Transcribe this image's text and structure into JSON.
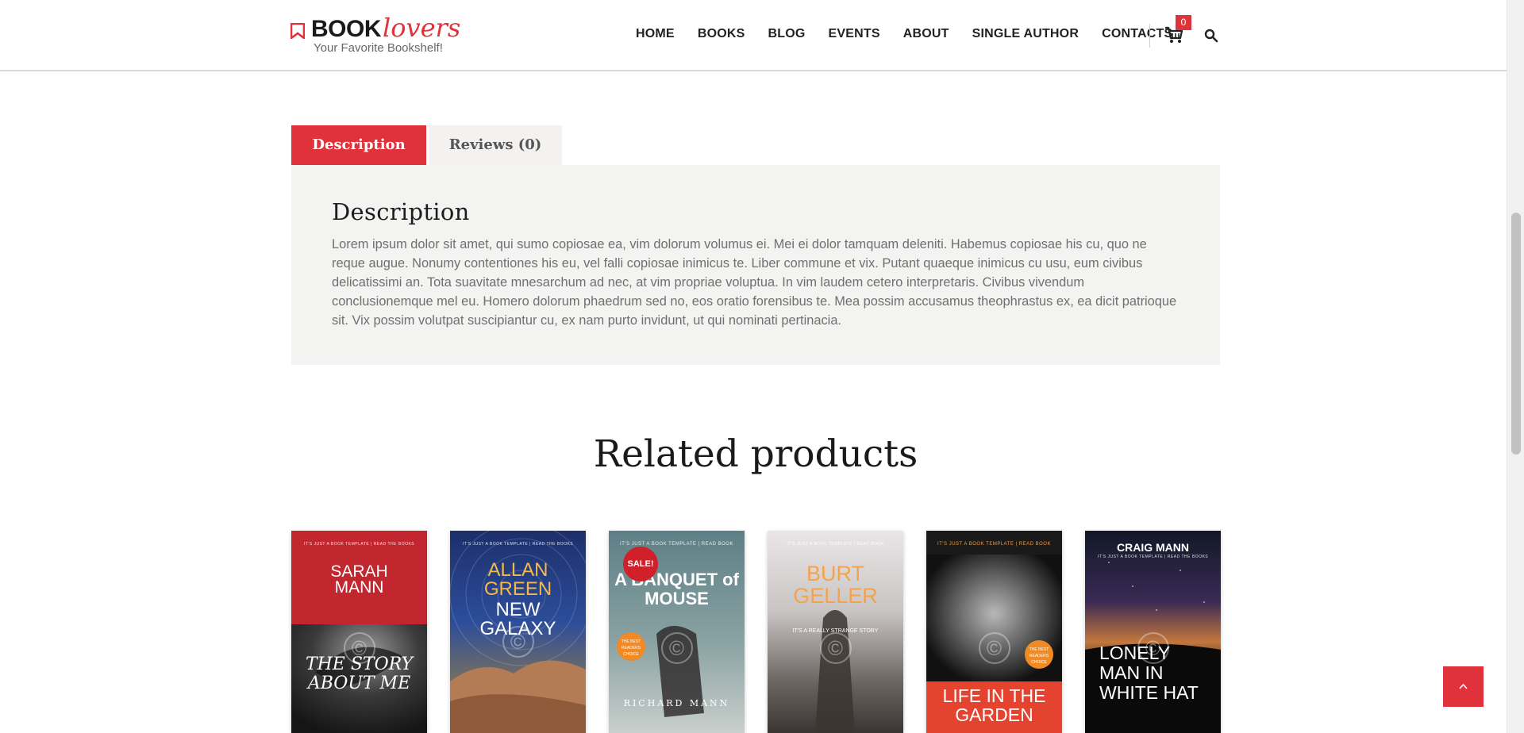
{
  "brand": {
    "name_bold": "BOOK",
    "name_italic": "lovers",
    "tagline": "Your Favorite Bookshelf!",
    "accent": "#e0323a"
  },
  "nav": {
    "items": [
      "HOME",
      "BOOKS",
      "BLOG",
      "EVENTS",
      "ABOUT",
      "SINGLE AUTHOR",
      "CONTACTS"
    ],
    "cart_count": "0"
  },
  "tabs": {
    "description_label": "Description",
    "reviews_label": "Reviews (0)"
  },
  "description": {
    "heading": "Description",
    "body": "Lorem ipsum dolor sit amet, qui sumo copiosae ea, vim dolorum volumus ei. Mei ei dolor tamquam deleniti. Habemus copiosae his cu, quo ne reque augue. Nonumy contentiones his eu, vel falli copiosae inimicus te. Liber commune et vix. Putant quaeque inimicus cu usu, eum civibus delicatissimi an. Tota suavitate mnesarchum ad nec, at vim propriae voluptua. In vim laudem cetero interpretaris. Civibus vivendum conclusionemque mel eu. Homero dolorum phaedrum sed no, eos oratio forensibus te. Mea possim accusamus theophrastus ex, ea dicit patrioque sit. Vix possim volutpat suscipiantur cu, ex nam purto invidunt, ut qui nominati pertinacia."
  },
  "related": {
    "heading": "Related products",
    "books": [
      {
        "author": "SARAH MANN",
        "title": "THE STORY ABOUT ME",
        "top": "IT'S JUST A BOOK TEMPLATE | READ THE BOOKS"
      },
      {
        "author": "ALLAN GREEN",
        "title": "NEW GALAXY",
        "top": "IT'S JUST A BOOK TEMPLATE | READ THE BOOKS"
      },
      {
        "author": "RICHARD MANN",
        "title": "A BANQUET of MOUSE",
        "top": "IT'S JUST A BOOK TEMPLATE | READ BOOK",
        "badge": "SALE!"
      },
      {
        "author": "BURT GELLER",
        "title": "IT'S A REALLY STRANGE STORY",
        "top": "IT'S JUST A BOOK TEMPLATE | READ BOOK"
      },
      {
        "author": "",
        "title": "LIFE IN THE GARDEN",
        "top": "IT'S JUST A BOOK TEMPLATE | READ BOOK"
      },
      {
        "author": "CRAIG MANN",
        "title": "LONELY MAN IN WHITE HAT",
        "top": "IT'S JUST A BOOK TEMPLATE | READ THE BOOKS"
      }
    ]
  }
}
